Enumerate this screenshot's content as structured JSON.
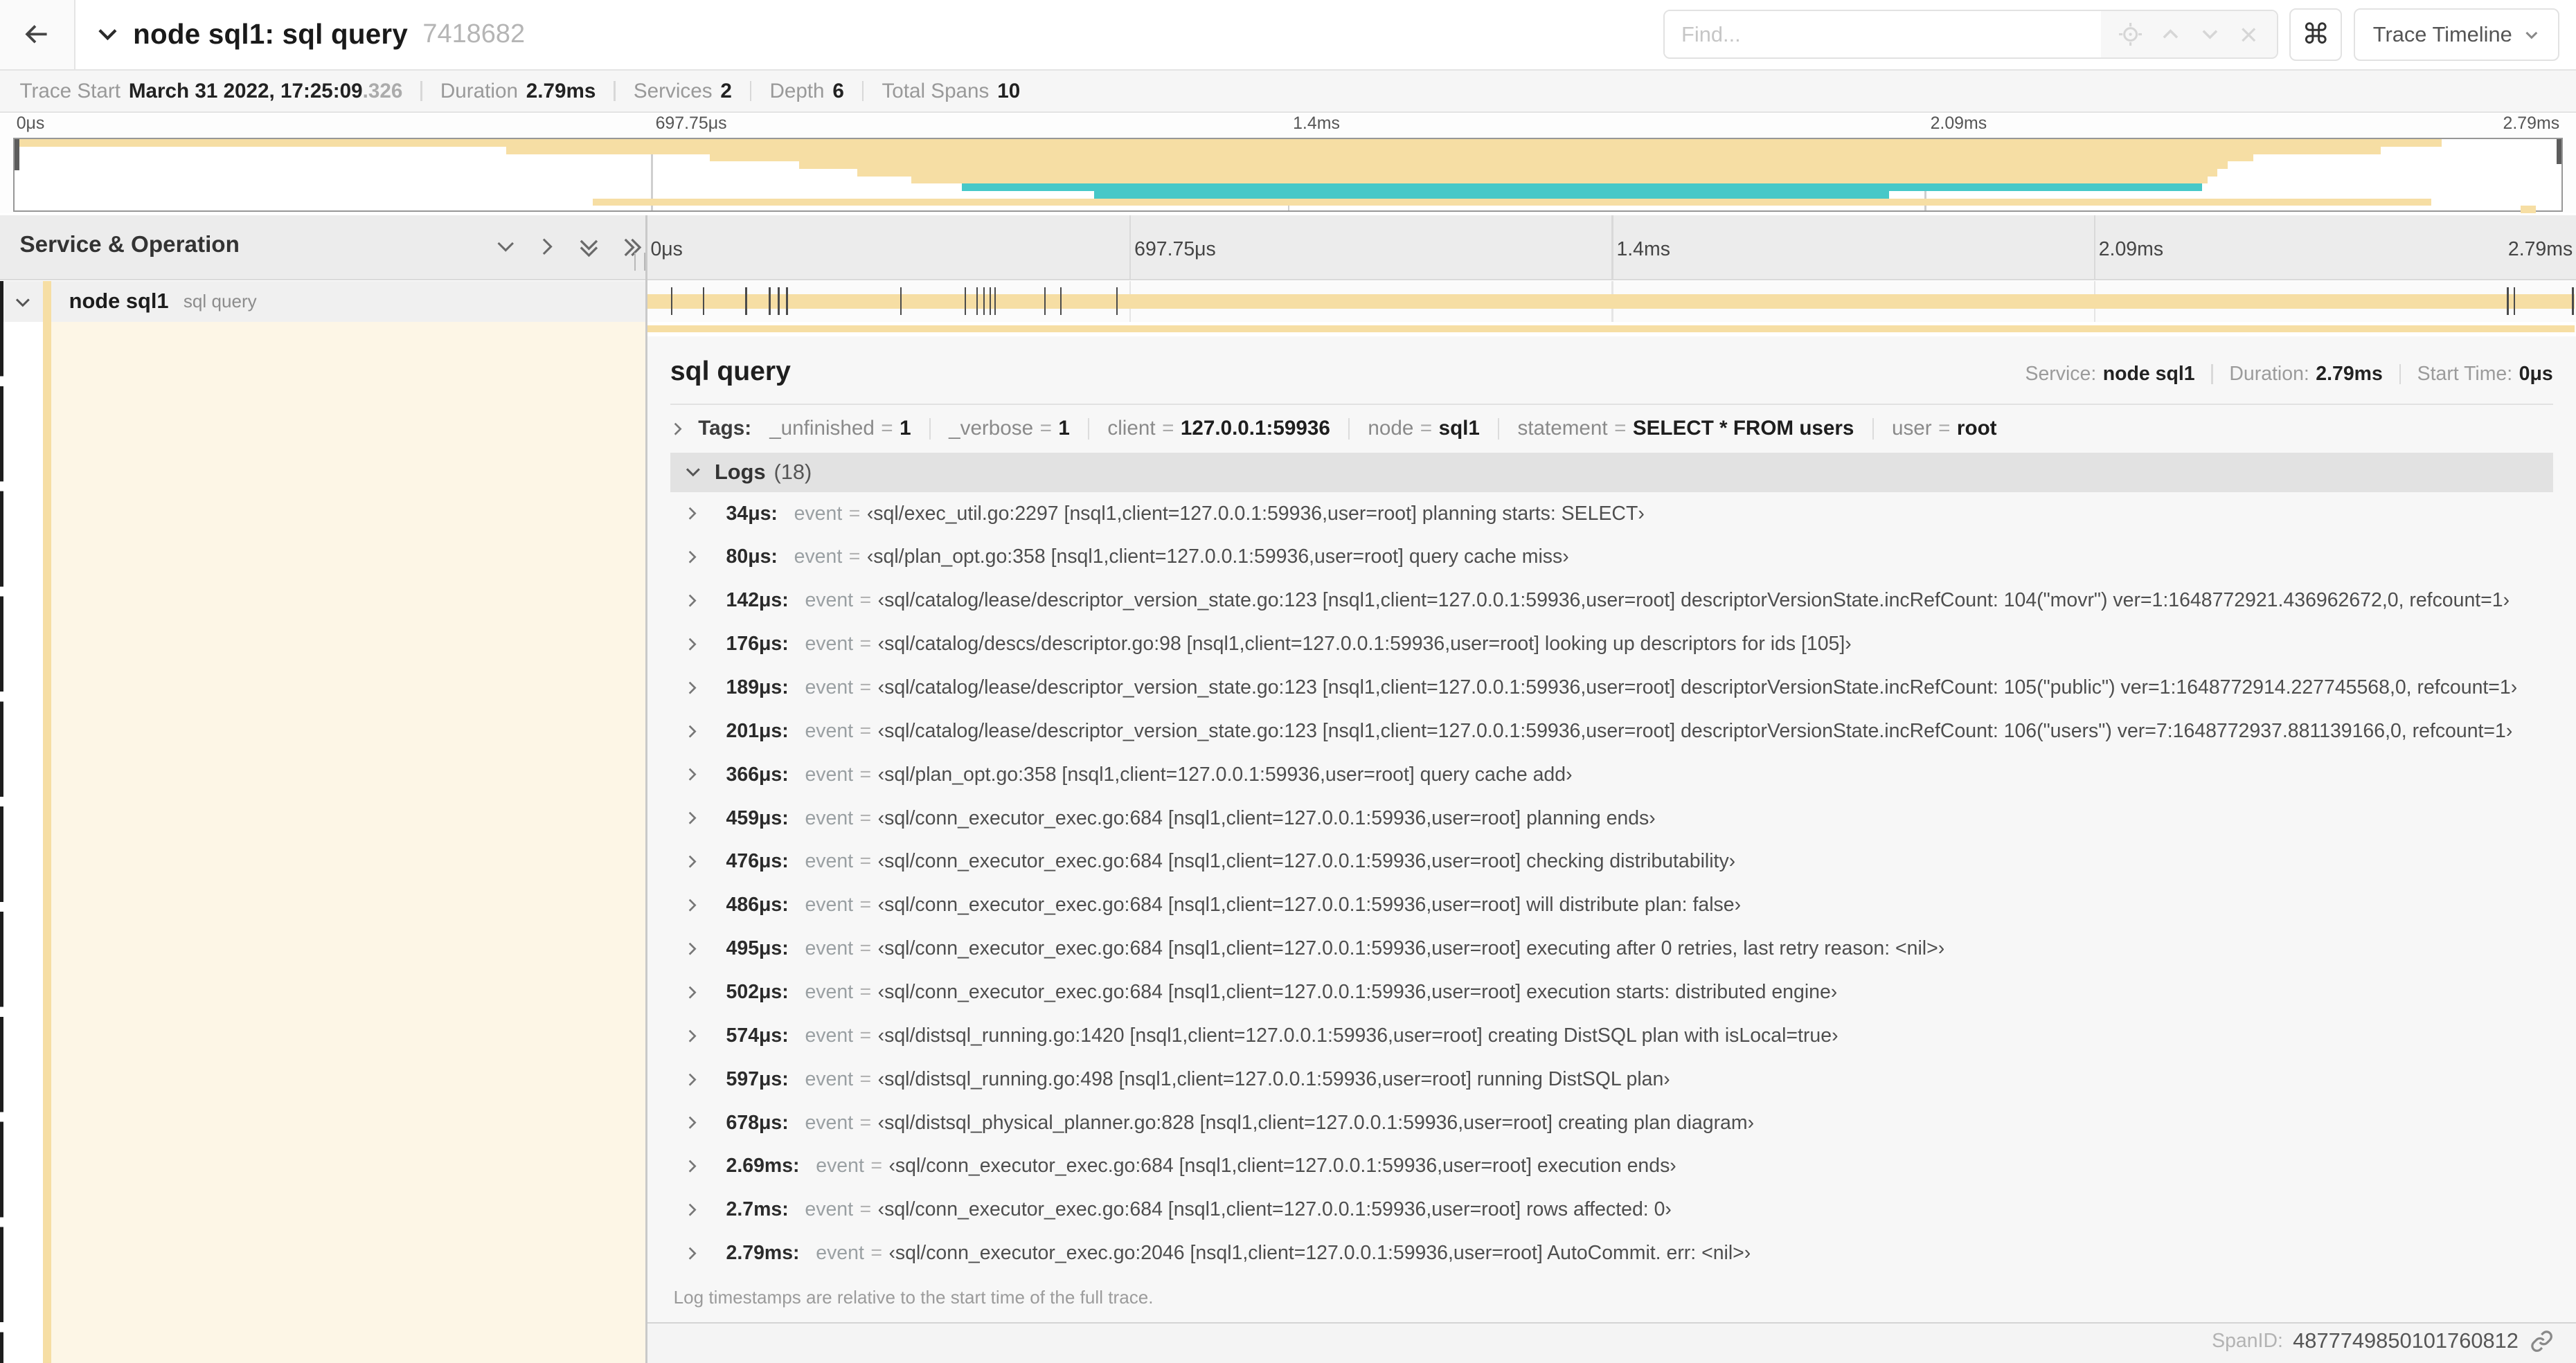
{
  "header": {
    "title": "node sql1: sql query",
    "trace_id_short": "7418682",
    "find_placeholder": "Find...",
    "shortcut_key": "⌘",
    "view_dropdown_label": "Trace Timeline"
  },
  "stats": {
    "trace_start_label": "Trace Start",
    "trace_start_value": "March 31 2022, 17:25:09",
    "trace_start_fraction": ".326",
    "duration_label": "Duration",
    "duration_value": "2.79ms",
    "services_label": "Services",
    "services_value": "2",
    "depth_label": "Depth",
    "depth_value": "6",
    "total_spans_label": "Total Spans",
    "total_spans_value": "10"
  },
  "timeline": {
    "ticks": [
      {
        "label": "0μs",
        "pos": 0
      },
      {
        "label": "697.75μs",
        "pos": 0.25
      },
      {
        "label": "1.4ms",
        "pos": 0.5
      },
      {
        "label": "2.09ms",
        "pos": 0.75
      },
      {
        "label": "2.79ms",
        "pos": 1
      }
    ],
    "gridlines": [
      0.25,
      0.5,
      0.75
    ]
  },
  "minimap": {
    "bars": [
      {
        "start": 0.0,
        "end": 0.953,
        "color": "span_tan"
      },
      {
        "start": 0.193,
        "end": 0.929,
        "color": "span_tan"
      },
      {
        "start": 0.273,
        "end": 0.879,
        "color": "span_tan"
      },
      {
        "start": 0.308,
        "end": 0.869,
        "color": "span_tan"
      },
      {
        "start": 0.331,
        "end": 0.865,
        "color": "span_tan"
      },
      {
        "start": 0.352,
        "end": 0.861,
        "color": "span_tan"
      },
      {
        "start": 0.372,
        "end": 0.859,
        "color": "span_teal"
      },
      {
        "start": 0.424,
        "end": 0.736,
        "color": "span_teal"
      },
      {
        "start": 0.227,
        "end": 0.949,
        "color": "span_tan"
      },
      {
        "start": 0.984,
        "end": 0.99,
        "color": "span_tan"
      }
    ]
  },
  "header_row": {
    "left_title": "Service & Operation"
  },
  "span_row": {
    "service": "node sql1",
    "operation": "sql query",
    "log_marker_positions": [
      0.0122,
      0.0287,
      0.0509,
      0.0631,
      0.0677,
      0.072,
      0.1312,
      0.1645,
      0.1706,
      0.1742,
      0.1774,
      0.1799,
      0.2057,
      0.214,
      0.243,
      0.9642,
      0.9677,
      0.998
    ]
  },
  "detail": {
    "title": "sql query",
    "service_label": "Service:",
    "service_value": "node sql1",
    "duration_label": "Duration:",
    "duration_value": "2.79ms",
    "start_time_label": "Start Time:",
    "start_time_value": "0μs",
    "tags_label": "Tags:",
    "tags": [
      {
        "key": "_unfinished",
        "value": "1"
      },
      {
        "key": "_verbose",
        "value": "1"
      },
      {
        "key": "client",
        "value": "127.0.0.1:59936"
      },
      {
        "key": "node",
        "value": "sql1"
      },
      {
        "key": "statement",
        "value": "SELECT * FROM users"
      },
      {
        "key": "user",
        "value": "root"
      }
    ],
    "logs_label": "Logs",
    "logs_count": "(18)",
    "log_field_name": "event",
    "logs": [
      {
        "time": "34μs:",
        "value": "‹sql/exec_util.go:2297 [nsql1,client=127.0.0.1:59936,user=root] planning starts: SELECT›"
      },
      {
        "time": "80μs:",
        "value": "‹sql/plan_opt.go:358 [nsql1,client=127.0.0.1:59936,user=root] query cache miss›"
      },
      {
        "time": "142μs:",
        "value": "‹sql/catalog/lease/descriptor_version_state.go:123 [nsql1,client=127.0.0.1:59936,user=root] descriptorVersionState.incRefCount: 104(\"movr\") ver=1:1648772921.436962672,0, refcount=1›"
      },
      {
        "time": "176μs:",
        "value": "‹sql/catalog/descs/descriptor.go:98 [nsql1,client=127.0.0.1:59936,user=root] looking up descriptors for ids [105]›"
      },
      {
        "time": "189μs:",
        "value": "‹sql/catalog/lease/descriptor_version_state.go:123 [nsql1,client=127.0.0.1:59936,user=root] descriptorVersionState.incRefCount: 105(\"public\") ver=1:1648772914.227745568,0, refcount=1›"
      },
      {
        "time": "201μs:",
        "value": "‹sql/catalog/lease/descriptor_version_state.go:123 [nsql1,client=127.0.0.1:59936,user=root] descriptorVersionState.incRefCount: 106(\"users\") ver=7:1648772937.881139166,0, refcount=1›"
      },
      {
        "time": "366μs:",
        "value": "‹sql/plan_opt.go:358 [nsql1,client=127.0.0.1:59936,user=root] query cache add›"
      },
      {
        "time": "459μs:",
        "value": "‹sql/conn_executor_exec.go:684 [nsql1,client=127.0.0.1:59936,user=root] planning ends›"
      },
      {
        "time": "476μs:",
        "value": "‹sql/conn_executor_exec.go:684 [nsql1,client=127.0.0.1:59936,user=root] checking distributability›"
      },
      {
        "time": "486μs:",
        "value": "‹sql/conn_executor_exec.go:684 [nsql1,client=127.0.0.1:59936,user=root] will distribute plan: false›"
      },
      {
        "time": "495μs:",
        "value": "‹sql/conn_executor_exec.go:684 [nsql1,client=127.0.0.1:59936,user=root] executing after 0 retries, last retry reason: <nil>›"
      },
      {
        "time": "502μs:",
        "value": "‹sql/conn_executor_exec.go:684 [nsql1,client=127.0.0.1:59936,user=root] execution starts: distributed engine›"
      },
      {
        "time": "574μs:",
        "value": "‹sql/distsql_running.go:1420 [nsql1,client=127.0.0.1:59936,user=root] creating DistSQL plan with isLocal=true›"
      },
      {
        "time": "597μs:",
        "value": "‹sql/distsql_running.go:498 [nsql1,client=127.0.0.1:59936,user=root] running DistSQL plan›"
      },
      {
        "time": "678μs:",
        "value": "‹sql/distsql_physical_planner.go:828 [nsql1,client=127.0.0.1:59936,user=root] creating plan diagram›"
      },
      {
        "time": "2.69ms:",
        "value": "‹sql/conn_executor_exec.go:684 [nsql1,client=127.0.0.1:59936,user=root] execution ends›"
      },
      {
        "time": "2.7ms:",
        "value": "‹sql/conn_executor_exec.go:684 [nsql1,client=127.0.0.1:59936,user=root] rows affected: 0›"
      },
      {
        "time": "2.79ms:",
        "value": "‹sql/conn_executor_exec.go:2046 [nsql1,client=127.0.0.1:59936,user=root] AutoCommit. err: <nil>›"
      }
    ],
    "footnote": "Log timestamps are relative to the start time of the full trace.",
    "spanid_label": "SpanID:",
    "spanid_value": "4877749850101760812"
  },
  "colors": {
    "span_tan": "#f6dea4",
    "span_teal": "#47c8c8",
    "detail_cream": "#fdf6e6",
    "marker_dark": "#4b4b4b"
  }
}
